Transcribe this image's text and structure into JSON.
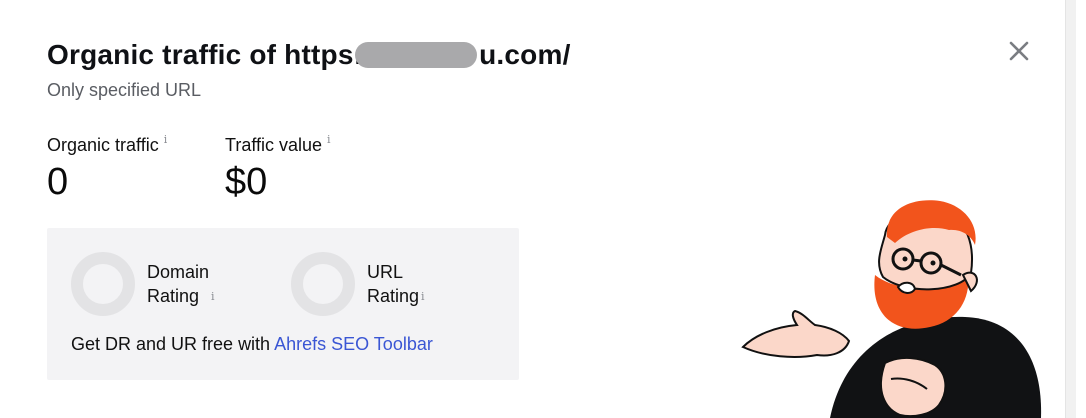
{
  "modal": {
    "title_prefix": "Organic traffic of https:",
    "title_suffix": "u.com/",
    "subtitle": "Only specified URL",
    "close_icon": "close-icon"
  },
  "metrics": [
    {
      "label": "Organic traffic",
      "value": "0",
      "info_icon": "i"
    },
    {
      "label": "Traffic value",
      "value": "$0",
      "info_icon": "i"
    }
  ],
  "ratings": {
    "domain": {
      "line1": "Domain",
      "line2": "Rating",
      "info_icon": "i"
    },
    "url": {
      "line1": "URL",
      "line2": "Rating",
      "info_icon": "i"
    },
    "cta_text": "Get DR and UR free with ",
    "cta_link": "Ahrefs SEO Toolbar",
    "link_color": "#3a56d4"
  },
  "colors": {
    "mascot_hair": "#f2541c",
    "ring": "#e3e3e5",
    "card_bg": "#f3f3f5"
  }
}
